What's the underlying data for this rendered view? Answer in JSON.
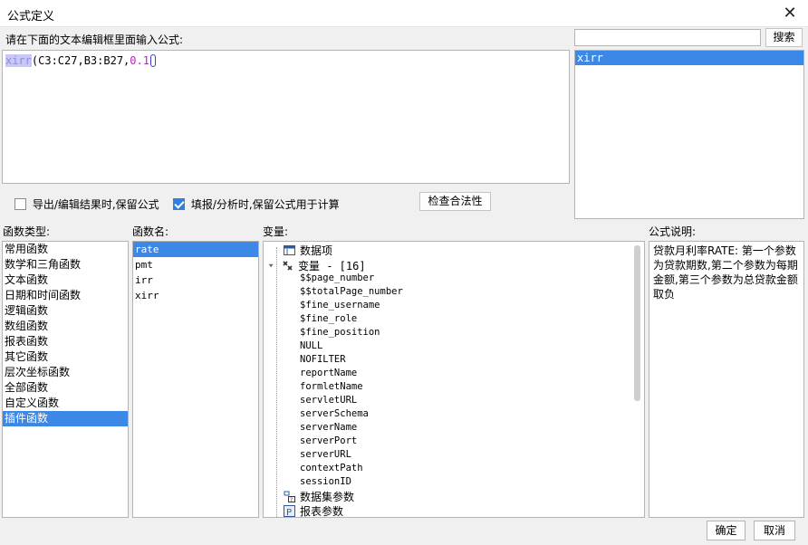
{
  "window": {
    "title": "公式定义",
    "close_glyph": "✕"
  },
  "editor": {
    "label": "请在下面的文本编辑框里面输入公式:",
    "formula_fn": "xirr",
    "formula_args": "(C3:C27,B3:B27,",
    "formula_num": "0.1",
    "formula_close": ")"
  },
  "search": {
    "placeholder": "",
    "button_label": "搜索",
    "results": [
      "xirr"
    ]
  },
  "options": {
    "keep_on_export_label": "导出/编辑结果时,保留公式",
    "keep_on_export_checked": false,
    "keep_on_fill_label": "填报/分析时,保留公式用于计算",
    "keep_on_fill_checked": true,
    "validate_label": "检查合法性"
  },
  "function_types": {
    "label": "函数类型:",
    "items": [
      "常用函数",
      "数学和三角函数",
      "文本函数",
      "日期和时间函数",
      "逻辑函数",
      "数组函数",
      "报表函数",
      "其它函数",
      "层次坐标函数",
      "全部函数",
      "自定义函数",
      "插件函数"
    ],
    "selected_index": 11
  },
  "function_names": {
    "label": "函数名:",
    "items": [
      "rate",
      "pmt",
      "irr",
      "xirr"
    ],
    "selected_index": 0
  },
  "variables": {
    "label": "变量:",
    "data_item": "数据项",
    "group_label": "变量 - [16]",
    "children": [
      "$$page_number",
      "$$totalPage_number",
      "$fine_username",
      "$fine_role",
      "$fine_position",
      "NULL",
      "NOFILTER",
      "reportName",
      "formletName",
      "servletURL",
      "serverSchema",
      "serverName",
      "serverPort",
      "serverURL",
      "contextPath",
      "sessionID"
    ],
    "dataset_params": "数据集参数",
    "report_params": "报表参数",
    "icons": [
      "table-icon",
      "expand-arrow-icon",
      "variable-icon",
      "dataset-param-icon",
      "report-param-icon"
    ]
  },
  "description": {
    "label": "公式说明:",
    "text": "贷款月利率RATE: 第一个参数为贷款期数,第二个参数为每期金额,第三个参数为总贷款金额取负"
  },
  "footer": {
    "ok_label": "确定",
    "cancel_label": "取消"
  },
  "colors": {
    "selection": "#3c88e6",
    "highlight": "#c9c8f5",
    "number": "#b22bb2"
  }
}
